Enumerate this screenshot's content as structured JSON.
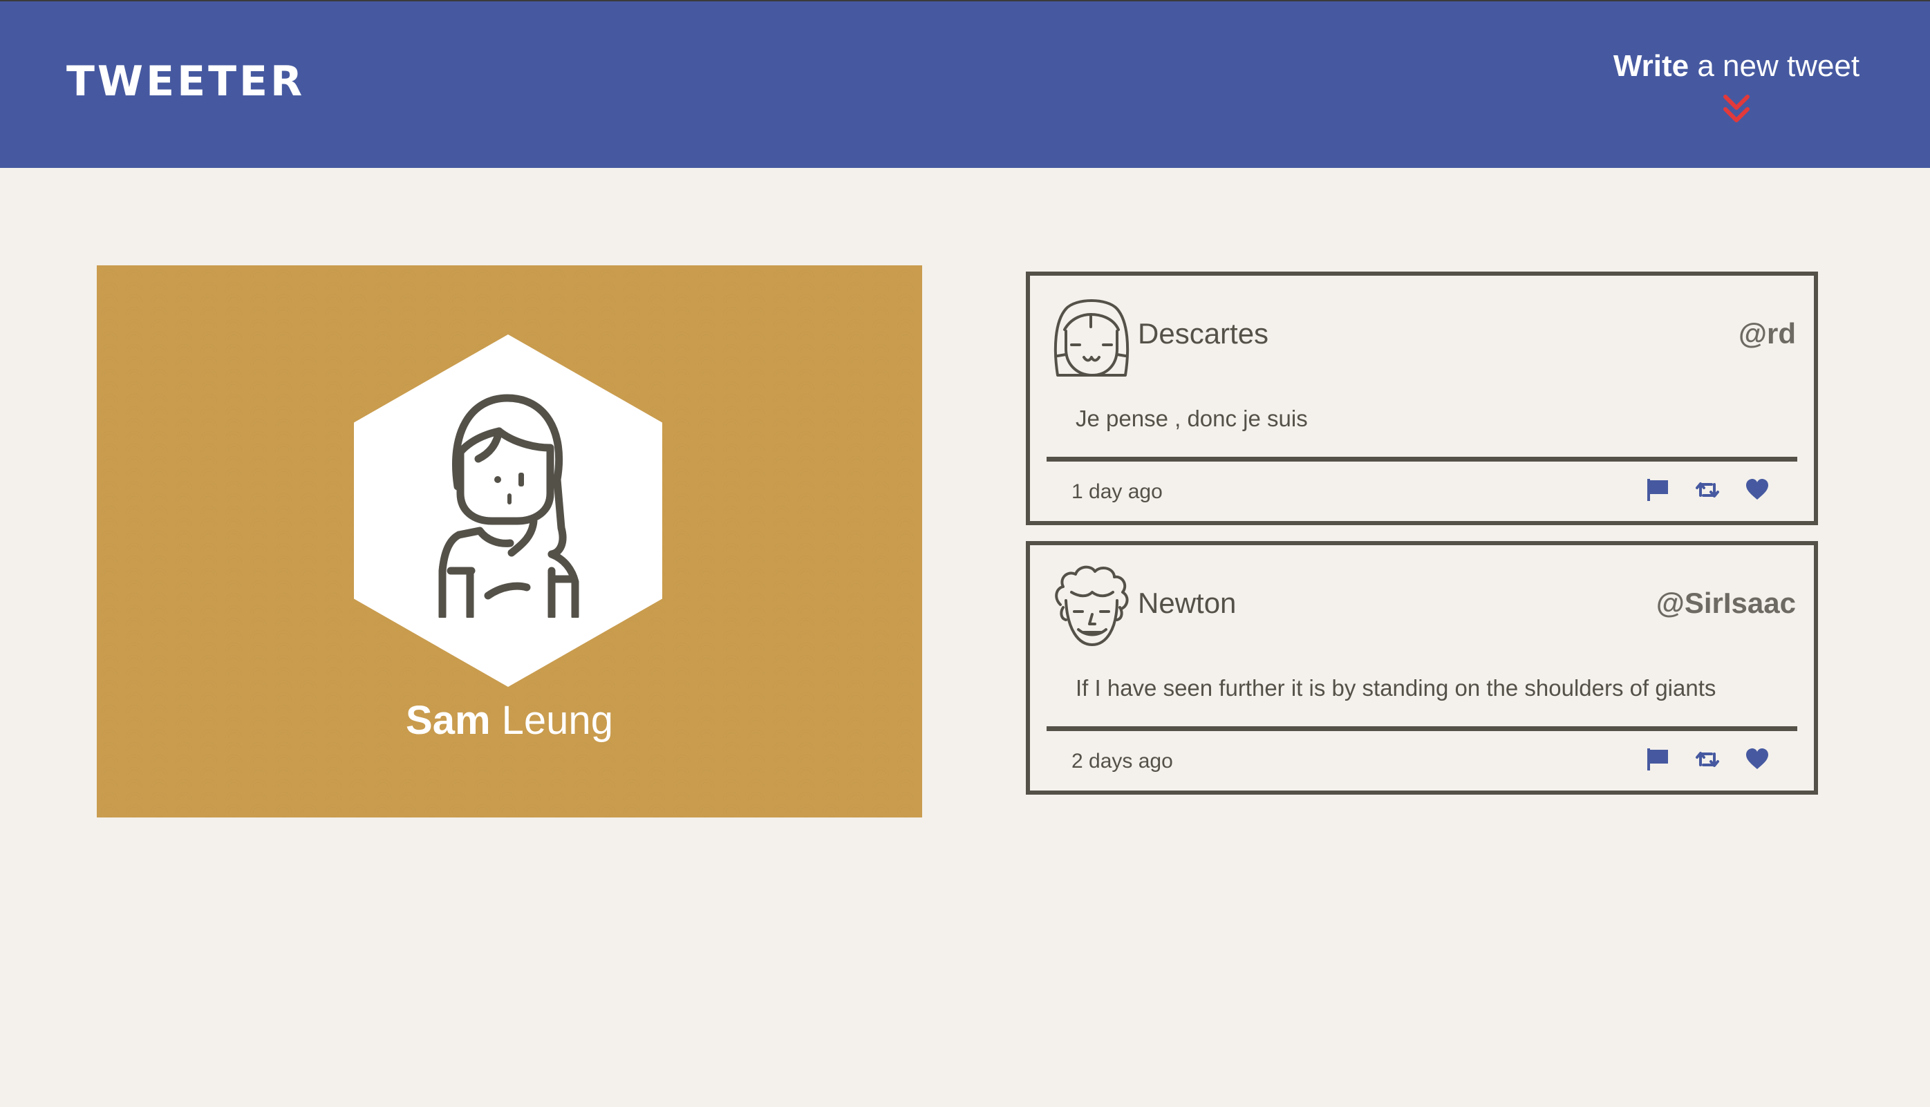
{
  "nav": {
    "logo": "TWEETER",
    "compose_strong": "Write",
    "compose_rest": " a new tweet",
    "compose_icon": "chevron-double-down-icon",
    "compose_icon_color": "#e2393b"
  },
  "profile": {
    "first_name": "Sam",
    "last_name": " Leung",
    "avatar_icon": "girl-avatar-icon",
    "background_color": "#c99c4e"
  },
  "tweets": [
    {
      "author": "Descartes",
      "handle": "@rd",
      "avatar_icon": "girl-face-avatar-icon",
      "body": "Je pense , donc je suis",
      "time": "1 day ago",
      "actions": [
        "flag-icon",
        "retweet-icon",
        "heart-icon"
      ]
    },
    {
      "author": "Newton",
      "handle": "@SirIsaac",
      "avatar_icon": "curly-hair-avatar-icon",
      "body": "If I have seen further it is by standing on the shoulders of giants",
      "time": "2 days ago",
      "actions": [
        "flag-icon",
        "retweet-icon",
        "heart-icon"
      ]
    }
  ],
  "colors": {
    "nav_bg": "#4659a0",
    "page_bg": "#f4f1ec",
    "text": "#545149",
    "icon_accent": "#4659a0"
  }
}
